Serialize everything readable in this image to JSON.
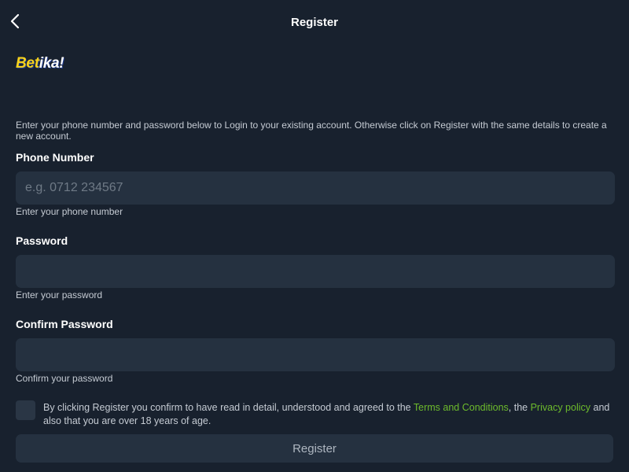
{
  "header": {
    "title": "Register",
    "back_icon": "chevron-left-icon"
  },
  "logo": {
    "part1": "Bet",
    "part2": "ika!"
  },
  "intro_text": "Enter your phone number and password below to Login to your existing account. Otherwise click on Register with the same details to create a new account.",
  "phone": {
    "label": "Phone Number",
    "placeholder": "e.g. 0712 234567",
    "value": "",
    "hint": "Enter your phone number"
  },
  "password": {
    "label": "Password",
    "value": "",
    "hint": "Enter your password"
  },
  "confirm_password": {
    "label": "Confirm Password",
    "value": "",
    "hint": "Confirm your password"
  },
  "consent": {
    "checked": false,
    "text_before": "By clicking Register you confirm to have read in detail, understood and agreed to the ",
    "terms_link": "Terms and Conditions",
    "text_middle": ", the ",
    "privacy_link": "Privacy policy",
    "text_after": " and also that you are over 18 years of age."
  },
  "register_button": "Register",
  "colors": {
    "background": "#18212e",
    "input_bg": "#253140",
    "link": "#6dbb2c",
    "logo_yellow": "#f7d21a"
  }
}
